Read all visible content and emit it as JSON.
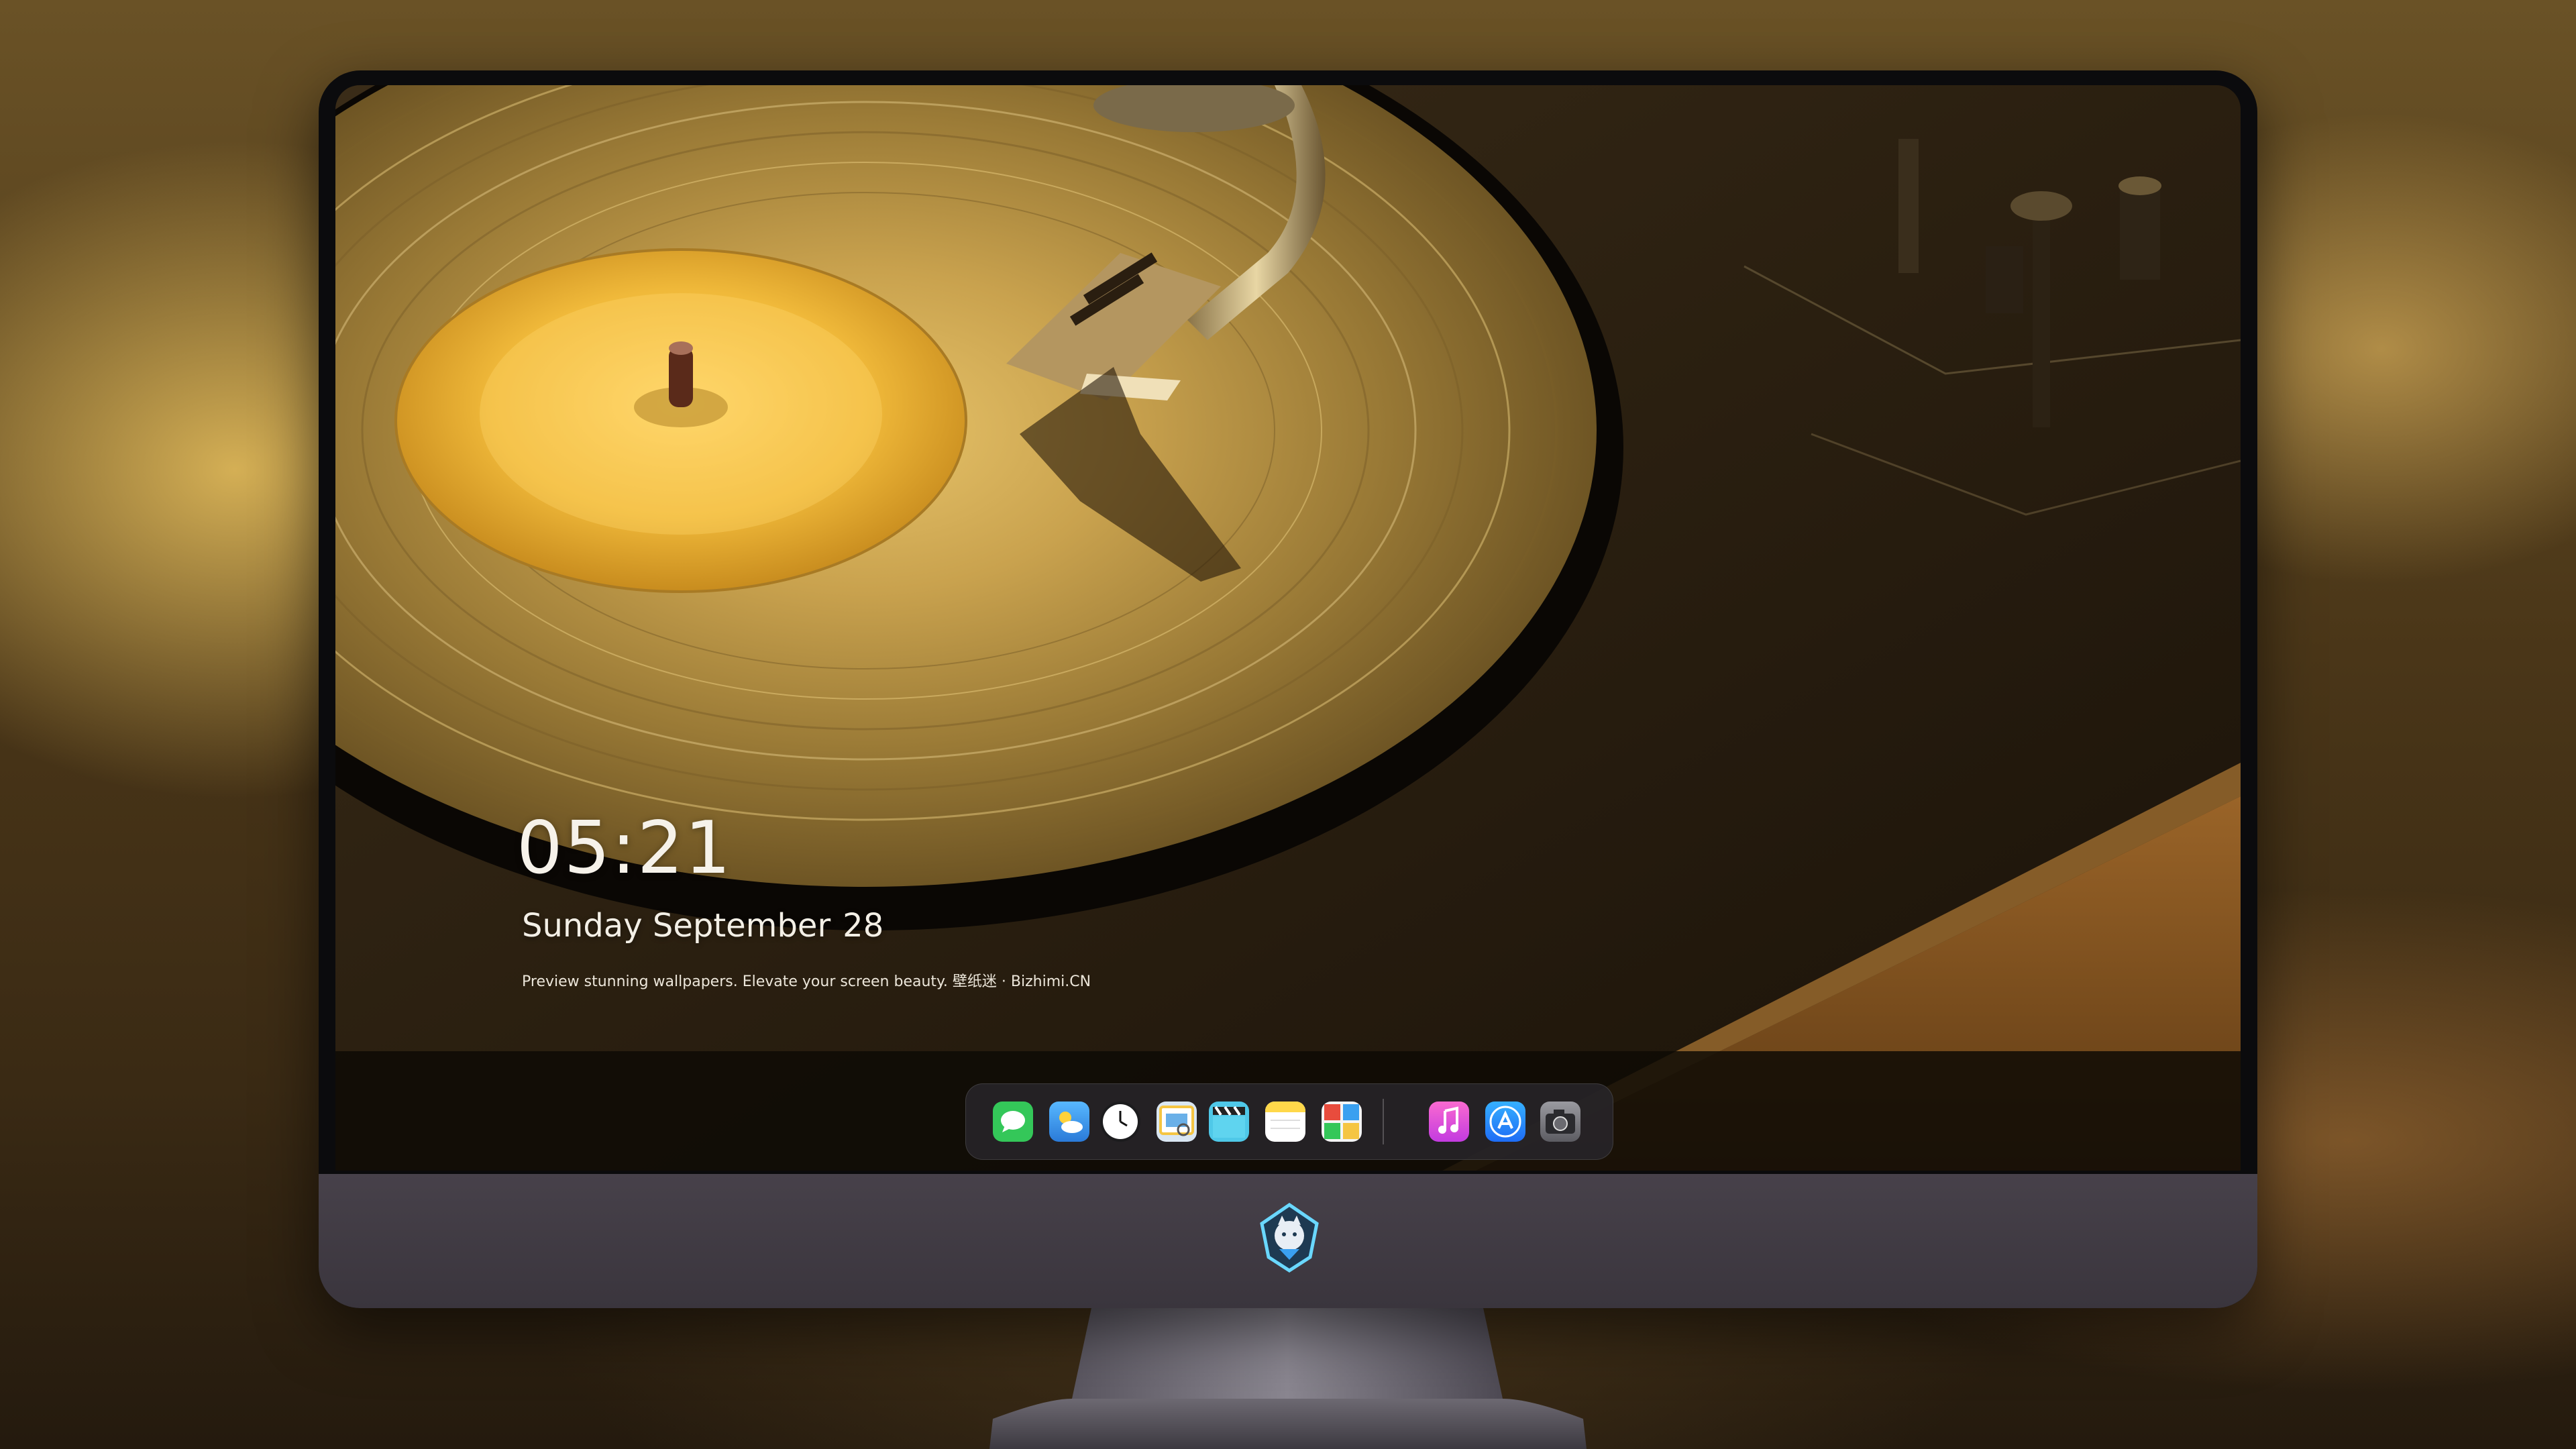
{
  "lockscreen": {
    "time": "05:21",
    "weekday_month": "Sunday September",
    "day": "28",
    "tagline": "Preview stunning wallpapers. Elevate your screen beauty. 壁纸迷 · Bizhimi.CN"
  },
  "dock": {
    "apps": [
      {
        "name": "messages-icon",
        "color": "#34c759"
      },
      {
        "name": "weather-icon",
        "color": "#3aa0f0"
      },
      {
        "name": "clock-icon",
        "color": "#ffffff"
      },
      {
        "name": "preview-icon",
        "color": "#f5c542"
      },
      {
        "name": "clips-icon",
        "color": "#4fc8e8"
      },
      {
        "name": "notes-icon",
        "color": "#ffd84a"
      },
      {
        "name": "photo-booth-icon",
        "color": "#e84c3d"
      },
      {
        "name": "music-icon",
        "color": "#fa57c1"
      },
      {
        "name": "app-store-icon",
        "color": "#1e8cf5"
      },
      {
        "name": "camera-icon",
        "color": "#8e8e93"
      }
    ]
  },
  "colors": {
    "accent_gold": "#d9a93f",
    "chin_gray": "#3f3a43",
    "bezel": "#0b0b0d"
  }
}
